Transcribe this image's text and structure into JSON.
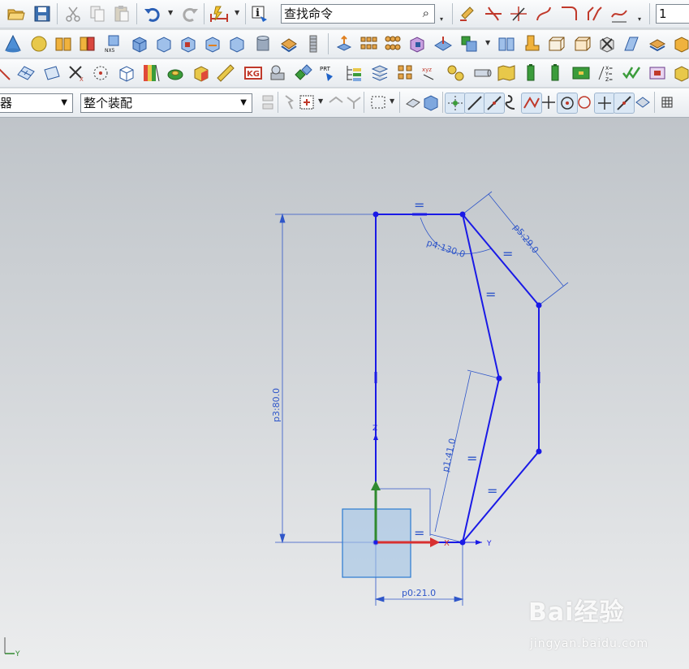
{
  "toolbar": {
    "search_label": "查找命令",
    "layer_value": "1",
    "filter_value": "器",
    "assembly_value": "整个装配"
  },
  "sketch": {
    "dimensions": {
      "p0": "p0:21.0",
      "p1": "p1:41.0",
      "p3": "p3:80.0",
      "p4": "p4:130.0",
      "p5": "p5:29.0"
    },
    "equal_symbol": "=",
    "axis_x": "X",
    "axis_y": "Y",
    "axis_z": "Z"
  },
  "colors": {
    "sketch_line": "#1a1ae6",
    "dimension": "#2f56c9",
    "axis_x": "#d83030",
    "axis_y": "#2f8a2f"
  },
  "watermark": {
    "logo": "Bai经验",
    "url": "jingyan.baidu.com"
  }
}
